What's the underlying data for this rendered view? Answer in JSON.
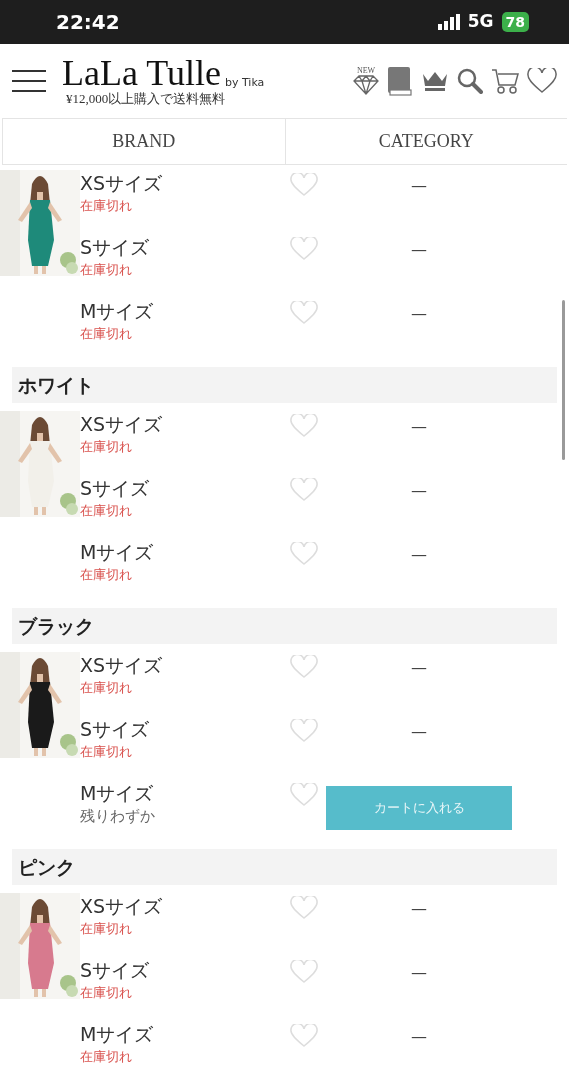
{
  "status_bar": {
    "time": "22:42",
    "network": "5G",
    "battery": "78"
  },
  "header": {
    "logo": "LaLa Tulle",
    "logo_suffix": "by Tika",
    "tagline": "¥12,000以上購入で送料無料",
    "new_label": "NEW"
  },
  "tabs": [
    {
      "label": "BRAND"
    },
    {
      "label": "CATEGORY"
    }
  ],
  "groups": [
    {
      "items": [
        {
          "size": "XSサイズ",
          "stock": "在庫切れ",
          "kind": "soldout",
          "action": "—"
        },
        {
          "size": "Sサイズ",
          "stock": "在庫切れ",
          "kind": "soldout",
          "action": "—"
        },
        {
          "size": "Mサイズ",
          "stock": "在庫切れ",
          "kind": "soldout",
          "action": "—"
        }
      ]
    },
    {
      "name": "ホワイト",
      "items": [
        {
          "size": "XSサイズ",
          "stock": "在庫切れ",
          "kind": "soldout",
          "action": "—"
        },
        {
          "size": "Sサイズ",
          "stock": "在庫切れ",
          "kind": "soldout",
          "action": "—"
        },
        {
          "size": "Mサイズ",
          "stock": "在庫切れ",
          "kind": "soldout",
          "action": "—"
        }
      ]
    },
    {
      "name": "ブラック",
      "items": [
        {
          "size": "XSサイズ",
          "stock": "在庫切れ",
          "kind": "soldout",
          "action": "—"
        },
        {
          "size": "Sサイズ",
          "stock": "在庫切れ",
          "kind": "soldout",
          "action": "—"
        },
        {
          "size": "Mサイズ",
          "stock": "残りわずか",
          "kind": "low",
          "button": "カートに入れる"
        }
      ]
    },
    {
      "name": "ピンク",
      "items": [
        {
          "size": "XSサイズ",
          "stock": "在庫切れ",
          "kind": "soldout",
          "action": "—"
        },
        {
          "size": "Sサイズ",
          "stock": "在庫切れ",
          "kind": "soldout",
          "action": "—"
        },
        {
          "size": "Mサイズ",
          "stock": "在庫切れ",
          "kind": "soldout",
          "action": "—"
        }
      ]
    }
  ]
}
